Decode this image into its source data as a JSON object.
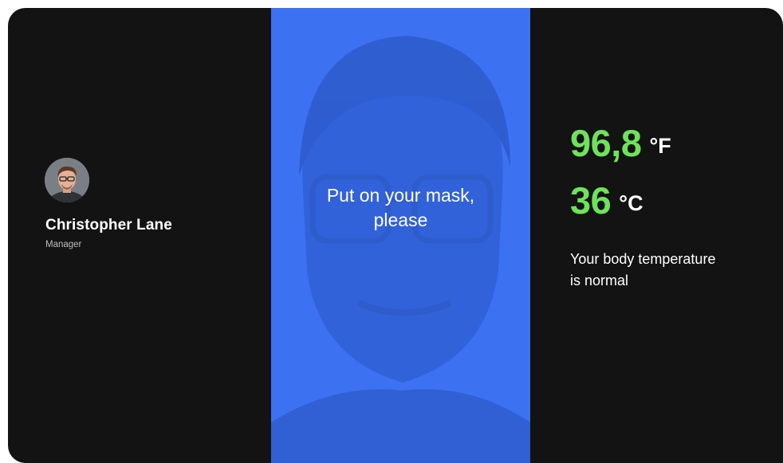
{
  "person": {
    "name": "Christopher Lane",
    "role": "Manager",
    "avatar_icon": "user-avatar-photo"
  },
  "prompt": {
    "line1": "Put on your mask,",
    "line2": "please"
  },
  "temperature": {
    "fahrenheit_value": "96,8",
    "fahrenheit_unit": "°F",
    "celsius_value": "36",
    "celsius_unit": "°C",
    "status_line1": "Your body temperature",
    "status_line2": "is normal"
  },
  "colors": {
    "background": "#131313",
    "center_panel": "#3c71f2",
    "temperature_value": "#6ee25a",
    "text": "#ffffff"
  }
}
